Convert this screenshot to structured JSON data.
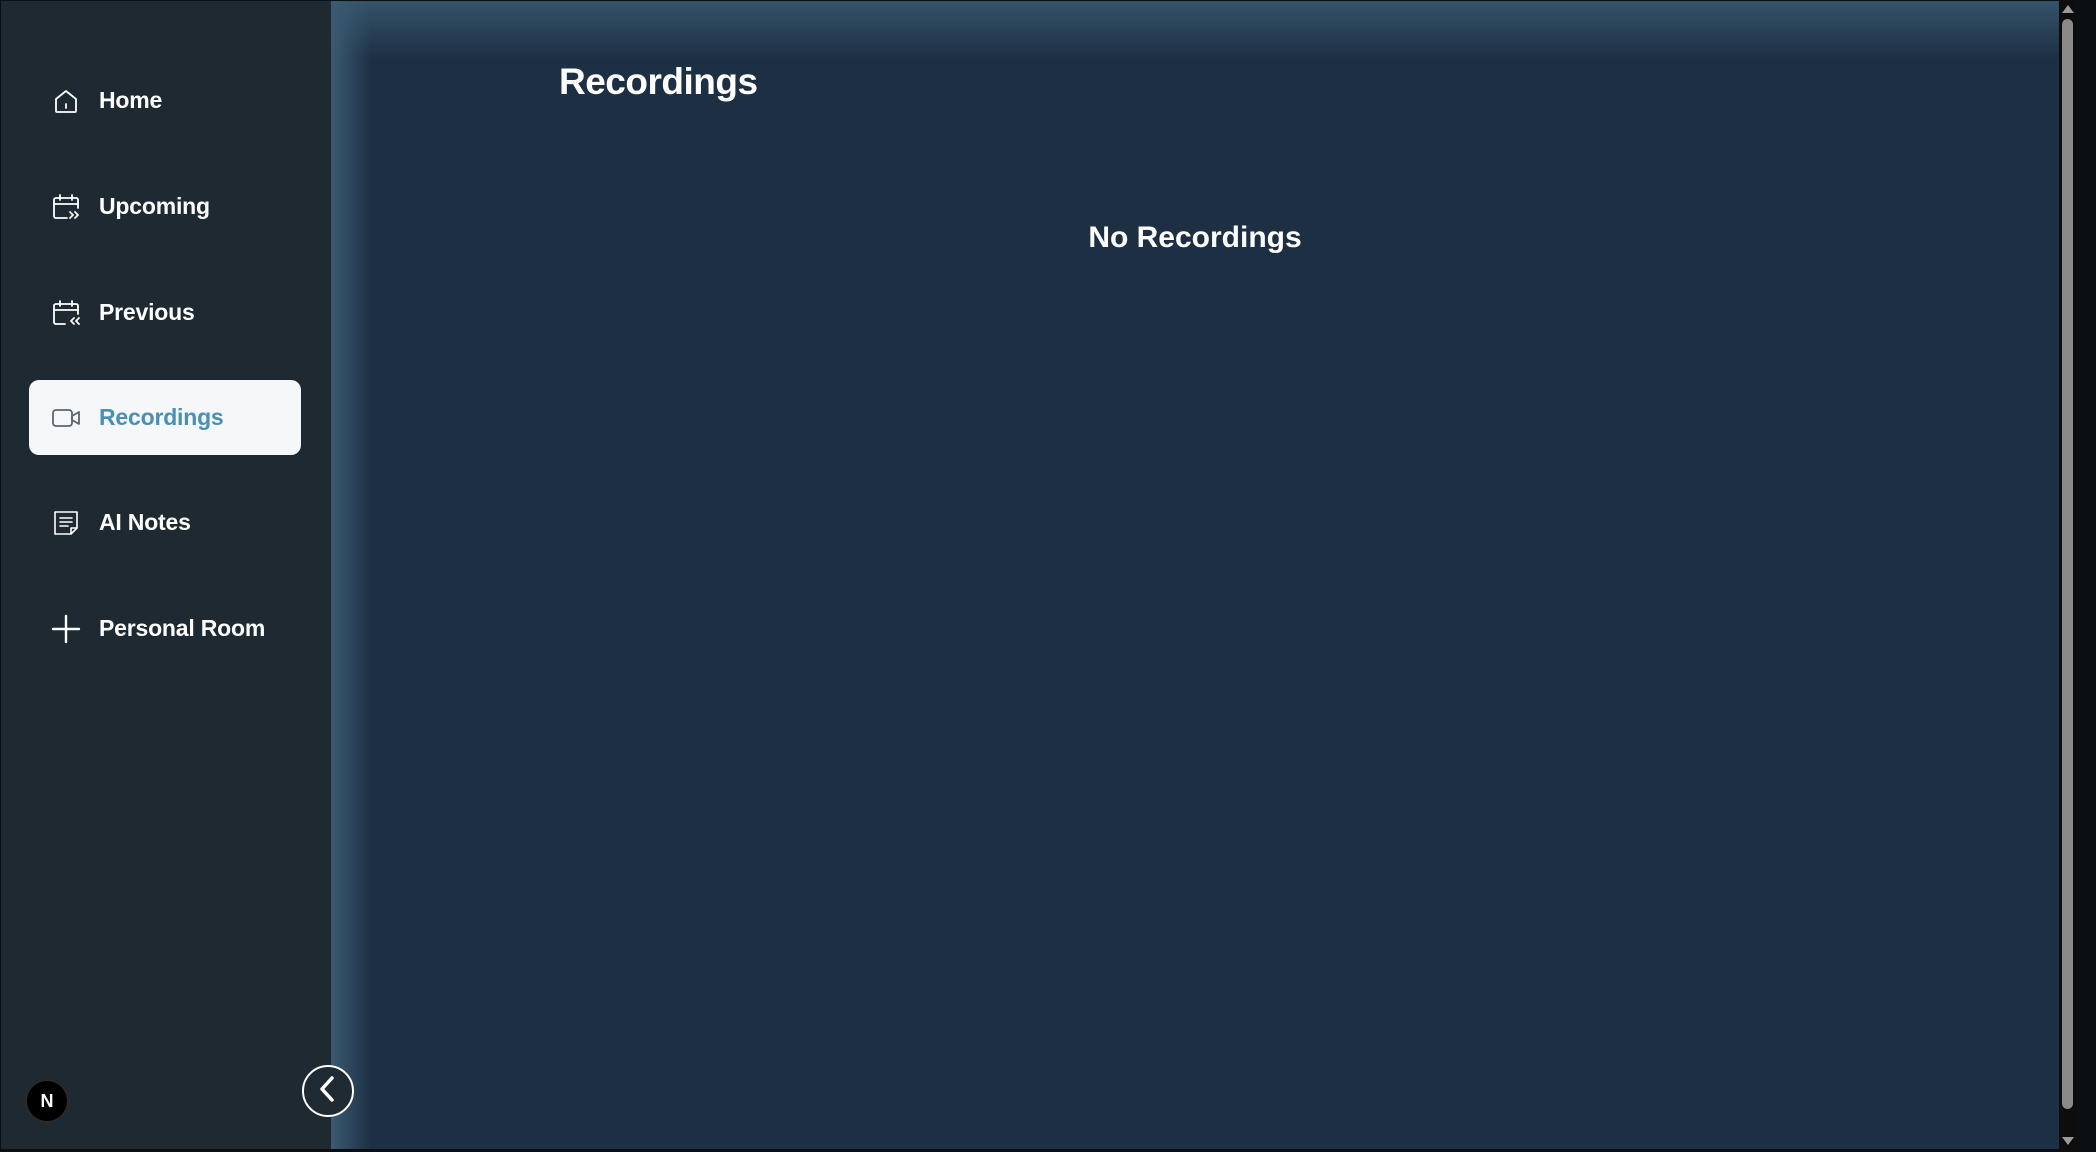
{
  "sidebar": {
    "items": [
      {
        "label": "Home",
        "icon": "home-icon",
        "active": false
      },
      {
        "label": "Upcoming",
        "icon": "calendar-forward-icon",
        "active": false
      },
      {
        "label": "Previous",
        "icon": "calendar-back-icon",
        "active": false
      },
      {
        "label": "Recordings",
        "icon": "video-icon",
        "active": true
      },
      {
        "label": "AI Notes",
        "icon": "notes-icon",
        "active": false
      },
      {
        "label": "Personal Room",
        "icon": "plus-icon",
        "active": false
      }
    ],
    "avatar_initial": "N"
  },
  "main": {
    "title": "Recordings",
    "empty_message": "No Recordings"
  },
  "colors": {
    "sidebar_bg": "#1f2932",
    "main_bg": "#1d3043",
    "active_item_bg": "#f5f7f8",
    "active_item_text": "#4a90b5"
  }
}
